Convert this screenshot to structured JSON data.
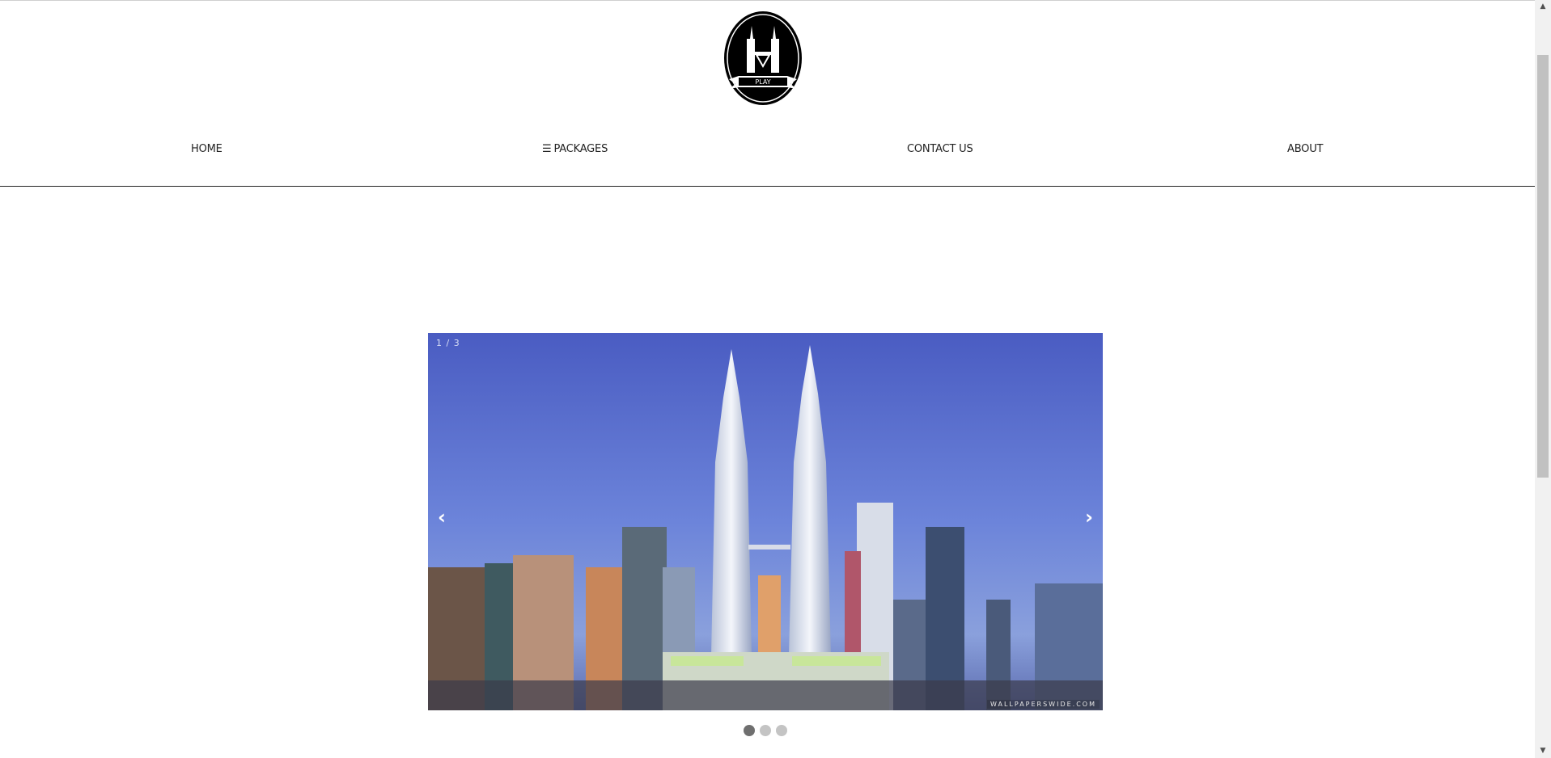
{
  "logo": {
    "text": "PLAY"
  },
  "nav": {
    "home": "HOME",
    "packages_glyph": "☰",
    "packages": "PACKAGES",
    "contact": "CONTACT US",
    "about": "ABOUT"
  },
  "slider": {
    "counter": "1 / 3",
    "prev": "‹",
    "next": "›",
    "watermark": "WALLPAPERSWIDE.COM",
    "slide_count": 3,
    "active_index": 0
  },
  "scrollbar": {
    "up": "▲",
    "down": "▼"
  }
}
